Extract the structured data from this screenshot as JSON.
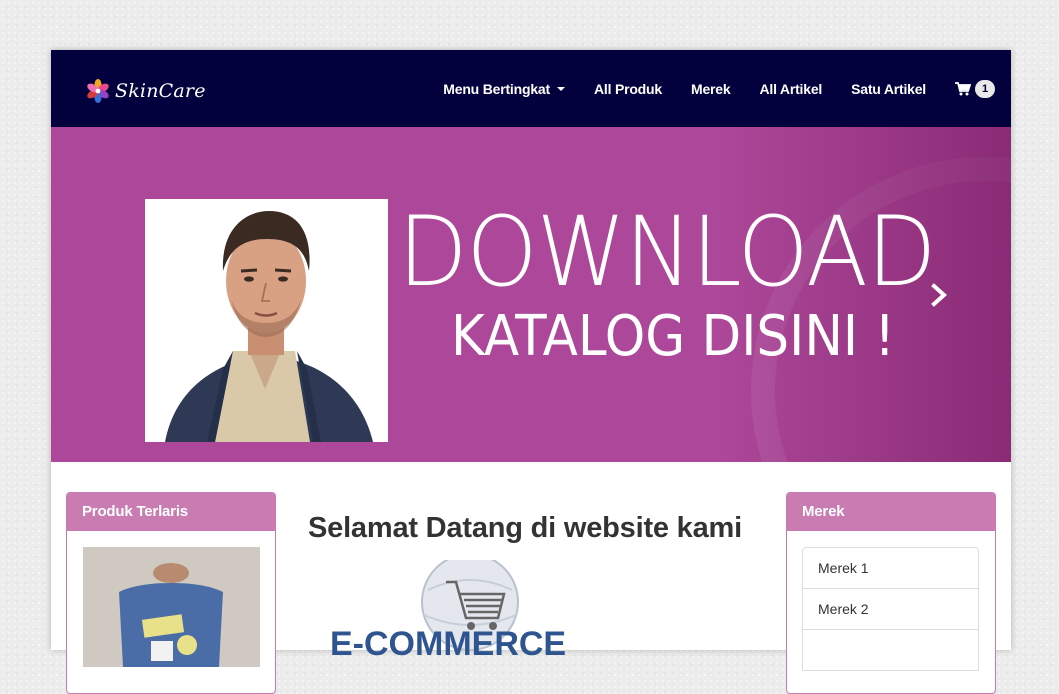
{
  "navbar": {
    "brand": "SkinCare",
    "items": [
      {
        "label": "Menu Bertingkat",
        "dropdown": true
      },
      {
        "label": "All Produk"
      },
      {
        "label": "Merek"
      },
      {
        "label": "All Artikel"
      },
      {
        "label": "Satu Artikel"
      }
    ],
    "cart_icon": "shopping-cart-icon",
    "cart_count": "1",
    "background": "#02013e"
  },
  "banner": {
    "title": "DOWNLOAD",
    "subtitle": "KATALOG DISINI !",
    "background": "#ad4799",
    "next_icon": "chevron-right-icon"
  },
  "sidebar_left": {
    "title": "Produk Terlaris",
    "header_color": "#c97cb2"
  },
  "main": {
    "welcome": "Selamat Datang di website kami",
    "ecommerce_logo_text": "E-COMMERCE"
  },
  "sidebar_right": {
    "title": "Merek",
    "items": [
      "Merek 1",
      "Merek 2"
    ]
  }
}
